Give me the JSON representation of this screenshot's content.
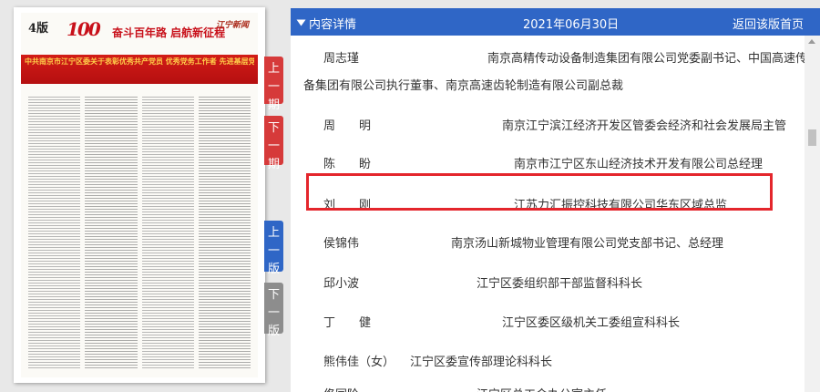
{
  "paper": {
    "issue_label": "4版",
    "logo_text": "100",
    "slogan": "奋斗百年路 启航新征程",
    "brand": "江宁新闻",
    "headline": "中共南京市江宁区委关于表彰优秀共产党员 优秀党务工作者 先进基层党组织的决定"
  },
  "side_nav": {
    "prev_issue": [
      "上",
      "一",
      "期"
    ],
    "next_issue": [
      "下",
      "一",
      "期"
    ],
    "prev_page": [
      "上",
      "一",
      "版"
    ],
    "next_page": [
      "下",
      "一",
      "版"
    ]
  },
  "header": {
    "title": "内容详情",
    "date": "2021年06月30日",
    "back_link": "返回该版首页"
  },
  "entries": [
    {
      "name": "周志瑾",
      "title": "南京高精传动设备制造集团有限公司党委副书记、中国高速传动设",
      "title_cont": "备集团有限公司执行董事、南京高速齿轮制造有限公司副总裁"
    },
    {
      "name": "周　　明",
      "title": "南京江宁滨江经济开发区管委会经济和社会发展局主管"
    },
    {
      "name": "陈　　盼",
      "title": "南京市江宁区东山经济技术开发有限公司总经理"
    },
    {
      "name": "刘　　刚",
      "title": "江苏力汇振控科技有限公司华东区域总监"
    },
    {
      "name": "侯锦伟",
      "title": "南京汤山新城物业管理有限公司党支部书记、总经理"
    },
    {
      "name": "邱小波",
      "title": "江宁区委组织部干部监督科科长"
    },
    {
      "name": "丁　　健",
      "title": "江宁区委区级机关工委组宣科科长"
    },
    {
      "name": "熊伟佳（女）",
      "title": "江宁区委宣传部理论科科长"
    },
    {
      "name": "佟同阶",
      "title": "江宁区总工会办公室主任"
    }
  ],
  "colors": {
    "header_bg": "#2f66c6",
    "issue_tab": "#d63a3a",
    "page_tab_active": "#2f66c6",
    "page_tab_disabled": "#8d8d8d",
    "highlight": "#e4262c"
  }
}
